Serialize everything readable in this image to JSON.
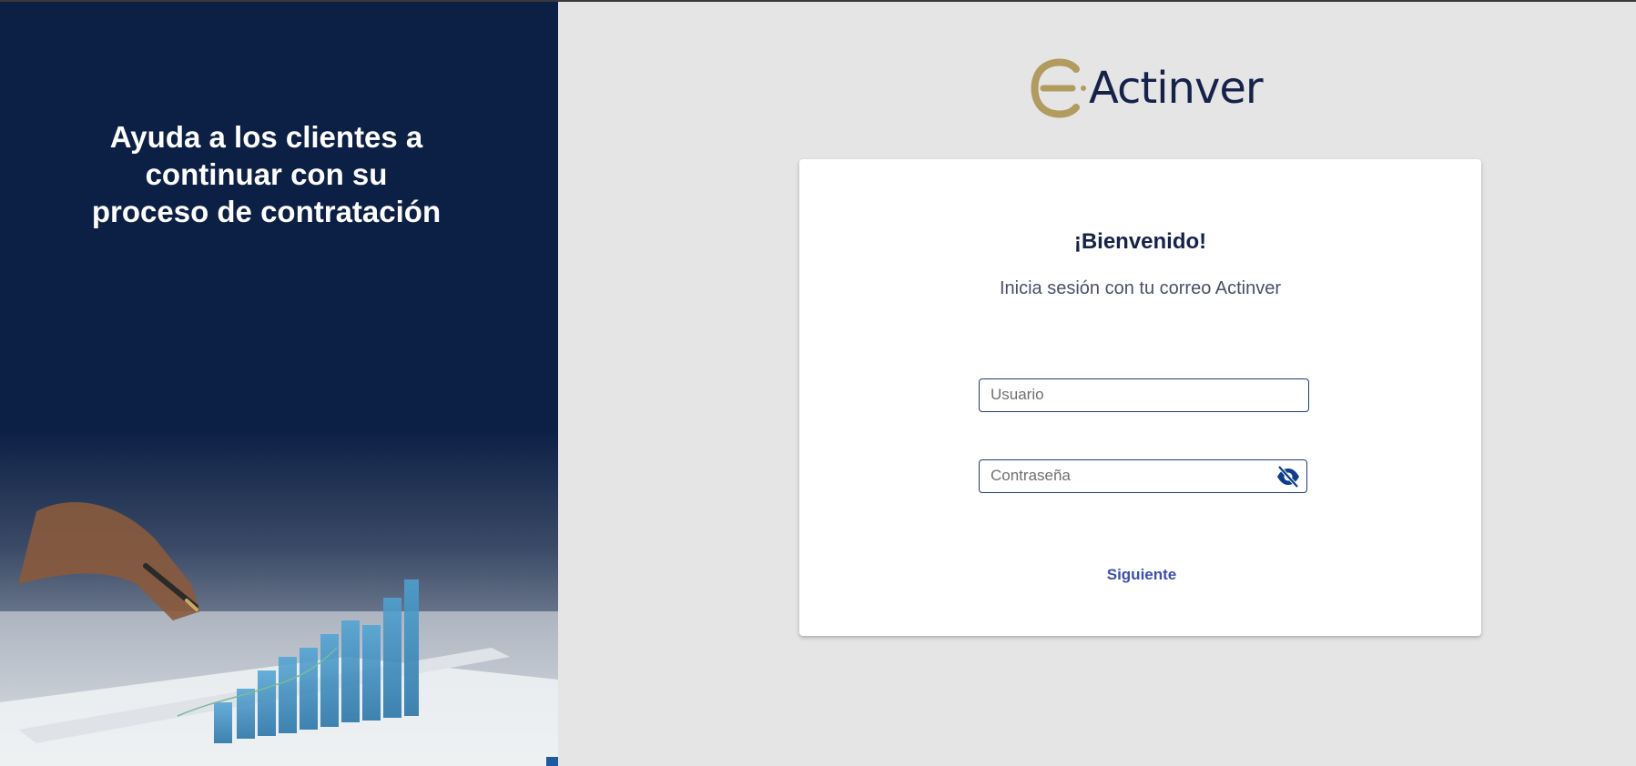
{
  "left_panel": {
    "title_lines": [
      "Ayuda a los clientes a",
      "continuar con su",
      "proceso de contratación"
    ]
  },
  "logo": {
    "text": "Actinver",
    "mark": "e-mark",
    "mark_color": "#b29b5f",
    "text_color": "#16224a"
  },
  "login": {
    "welcome": "¡Bienvenido!",
    "subtitle": "Inicia sesión con tu correo Actinver",
    "username_placeholder": "Usuario",
    "password_placeholder": "Contraseña",
    "toggle_icon": "eye-off-icon",
    "next_label": "Siguiente"
  },
  "colors": {
    "navy": "#0c1f45",
    "accent": "#3c4fb0",
    "field_border": "#233a73"
  }
}
